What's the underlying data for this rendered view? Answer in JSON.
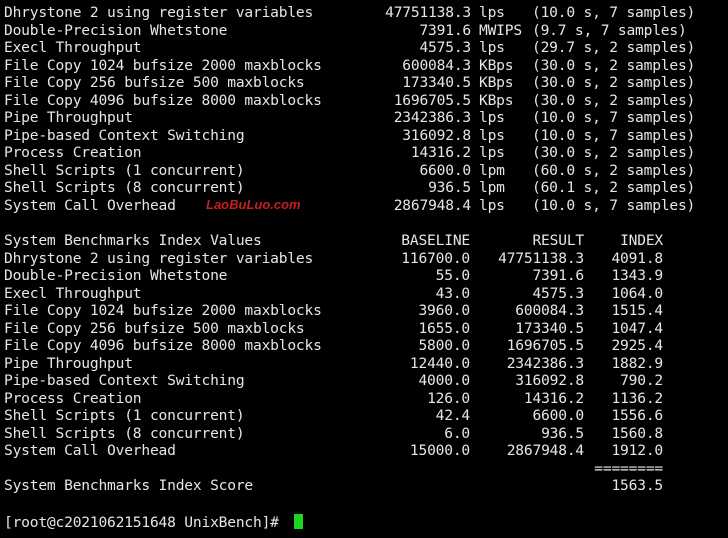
{
  "watermark": "LaoBuLuo.com",
  "results": [
    {
      "name": "Dhrystone 2 using register variables",
      "value": "47751138.3",
      "unit": "lps",
      "info": "(10.0 s, 7 samples)"
    },
    {
      "name": "Double-Precision Whetstone",
      "value": "7391.6",
      "unit": "MWIPS",
      "info": "(9.7 s, 7 samples)"
    },
    {
      "name": "Execl Throughput",
      "value": "4575.3",
      "unit": "lps",
      "info": "(29.7 s, 2 samples)"
    },
    {
      "name": "File Copy 1024 bufsize 2000 maxblocks",
      "value": "600084.3",
      "unit": "KBps",
      "info": "(30.0 s, 2 samples)"
    },
    {
      "name": "File Copy 256 bufsize 500 maxblocks",
      "value": "173340.5",
      "unit": "KBps",
      "info": "(30.0 s, 2 samples)"
    },
    {
      "name": "File Copy 4096 bufsize 8000 maxblocks",
      "value": "1696705.5",
      "unit": "KBps",
      "info": "(30.0 s, 2 samples)"
    },
    {
      "name": "Pipe Throughput",
      "value": "2342386.3",
      "unit": "lps",
      "info": "(10.0 s, 7 samples)"
    },
    {
      "name": "Pipe-based Context Switching",
      "value": "316092.8",
      "unit": "lps",
      "info": "(10.0 s, 7 samples)"
    },
    {
      "name": "Process Creation",
      "value": "14316.2",
      "unit": "lps",
      "info": "(30.0 s, 2 samples)"
    },
    {
      "name": "Shell Scripts (1 concurrent)",
      "value": "6600.0",
      "unit": "lpm",
      "info": "(60.0 s, 2 samples)"
    },
    {
      "name": "Shell Scripts (8 concurrent)",
      "value": "936.5",
      "unit": "lpm",
      "info": "(60.1 s, 2 samples)"
    },
    {
      "name": "System Call Overhead",
      "value": "2867948.4",
      "unit": "lps",
      "info": "(10.0 s, 7 samples)"
    }
  ],
  "index_header": {
    "title": "System Benchmarks Index Values",
    "baseline": "BASELINE",
    "result": "RESULT",
    "index": "INDEX"
  },
  "index_rows": [
    {
      "name": "Dhrystone 2 using register variables",
      "baseline": "116700.0",
      "result": "47751138.3",
      "index": "4091.8"
    },
    {
      "name": "Double-Precision Whetstone",
      "baseline": "55.0",
      "result": "7391.6",
      "index": "1343.9"
    },
    {
      "name": "Execl Throughput",
      "baseline": "43.0",
      "result": "4575.3",
      "index": "1064.0"
    },
    {
      "name": "File Copy 1024 bufsize 2000 maxblocks",
      "baseline": "3960.0",
      "result": "600084.3",
      "index": "1515.4"
    },
    {
      "name": "File Copy 256 bufsize 500 maxblocks",
      "baseline": "1655.0",
      "result": "173340.5",
      "index": "1047.4"
    },
    {
      "name": "File Copy 4096 bufsize 8000 maxblocks",
      "baseline": "5800.0",
      "result": "1696705.5",
      "index": "2925.4"
    },
    {
      "name": "Pipe Throughput",
      "baseline": "12440.0",
      "result": "2342386.3",
      "index": "1882.9"
    },
    {
      "name": "Pipe-based Context Switching",
      "baseline": "4000.0",
      "result": "316092.8",
      "index": "790.2"
    },
    {
      "name": "Process Creation",
      "baseline": "126.0",
      "result": "14316.2",
      "index": "1136.2"
    },
    {
      "name": "Shell Scripts (1 concurrent)",
      "baseline": "42.4",
      "result": "6600.0",
      "index": "1556.6"
    },
    {
      "name": "Shell Scripts (8 concurrent)",
      "baseline": "6.0",
      "result": "936.5",
      "index": "1560.8"
    },
    {
      "name": "System Call Overhead",
      "baseline": "15000.0",
      "result": "2867948.4",
      "index": "1912.0"
    }
  ],
  "separator": "========",
  "score": {
    "label": "System Benchmarks Index Score",
    "value": "1563.5"
  },
  "prompt": "[root@c2021062151648 UnixBench]# "
}
